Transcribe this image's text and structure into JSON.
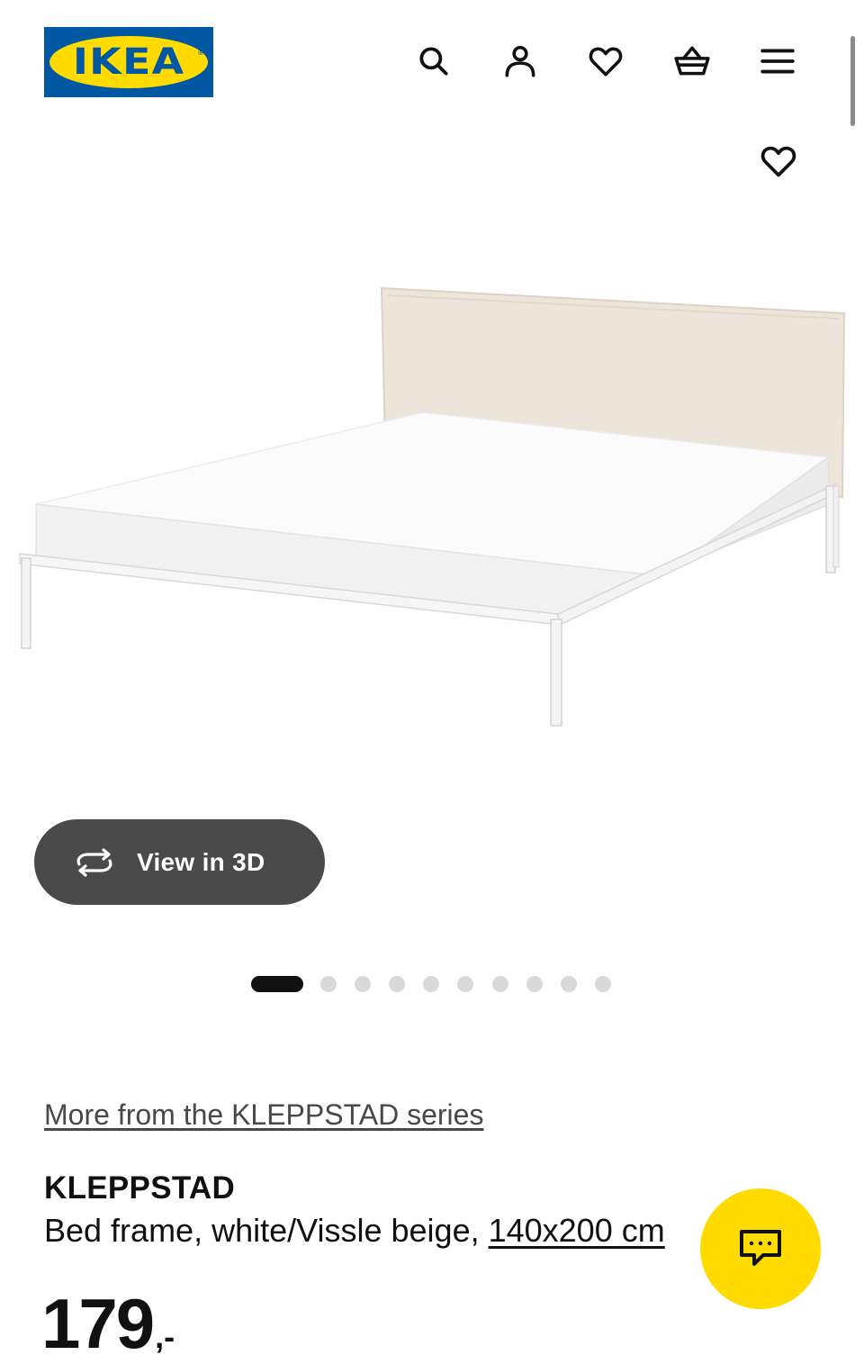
{
  "header": {
    "logo_text": "IKEA",
    "logo_registered": "®",
    "icons": [
      "search-icon",
      "account-icon",
      "heart-icon",
      "basket-icon",
      "menu-icon"
    ]
  },
  "product": {
    "image_alt": "KLEPPSTAD bed frame",
    "view_3d_label": "View in 3D",
    "carousel": {
      "total": 10,
      "active": 1
    },
    "series_link": "More from the KLEPPSTAD series",
    "name": "KLEPPSTAD",
    "description": "Bed frame, white/Vissle beige, ",
    "size_link": "140x200 cm",
    "price_integer": "179",
    "price_suffix": ",-"
  },
  "colors": {
    "brand_blue": "#0058a3",
    "brand_yellow": "#ffdb00",
    "view3d_bg": "#4a4a4a",
    "dot_inactive": "#d9d9d9",
    "dot_active": "#111111"
  }
}
